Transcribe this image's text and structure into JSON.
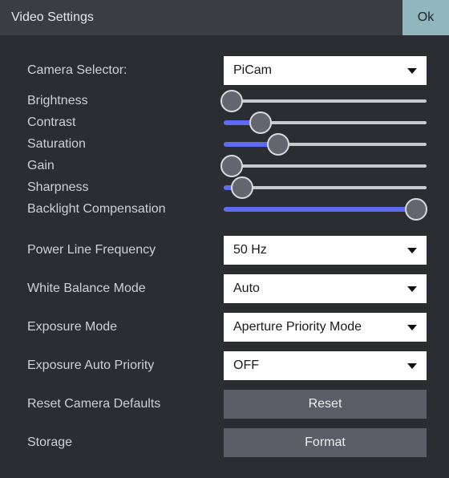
{
  "title": "Video Settings",
  "ok": "Ok",
  "camera_selector": {
    "label": "Camera Selector:",
    "value": "PiCam"
  },
  "sliders": {
    "brightness": {
      "label": "Brightness",
      "value": 4
    },
    "contrast": {
      "label": "Contrast",
      "value": 18
    },
    "saturation": {
      "label": "Saturation",
      "value": 27
    },
    "gain": {
      "label": "Gain",
      "value": 4
    },
    "sharpness": {
      "label": "Sharpness",
      "value": 9
    },
    "backlight": {
      "label": "Backlight Compensation",
      "value": 95
    }
  },
  "power_line": {
    "label": "Power Line Frequency",
    "value": "50 Hz"
  },
  "white_balance": {
    "label": "White Balance Mode",
    "value": "Auto"
  },
  "exposure_mode": {
    "label": "Exposure Mode",
    "value": "Aperture Priority Mode"
  },
  "exposure_auto_pri": {
    "label": "Exposure Auto Priority",
    "value": "OFF"
  },
  "reset": {
    "label": "Reset Camera Defaults",
    "button": "Reset"
  },
  "storage": {
    "label": "Storage",
    "button": "Format"
  }
}
